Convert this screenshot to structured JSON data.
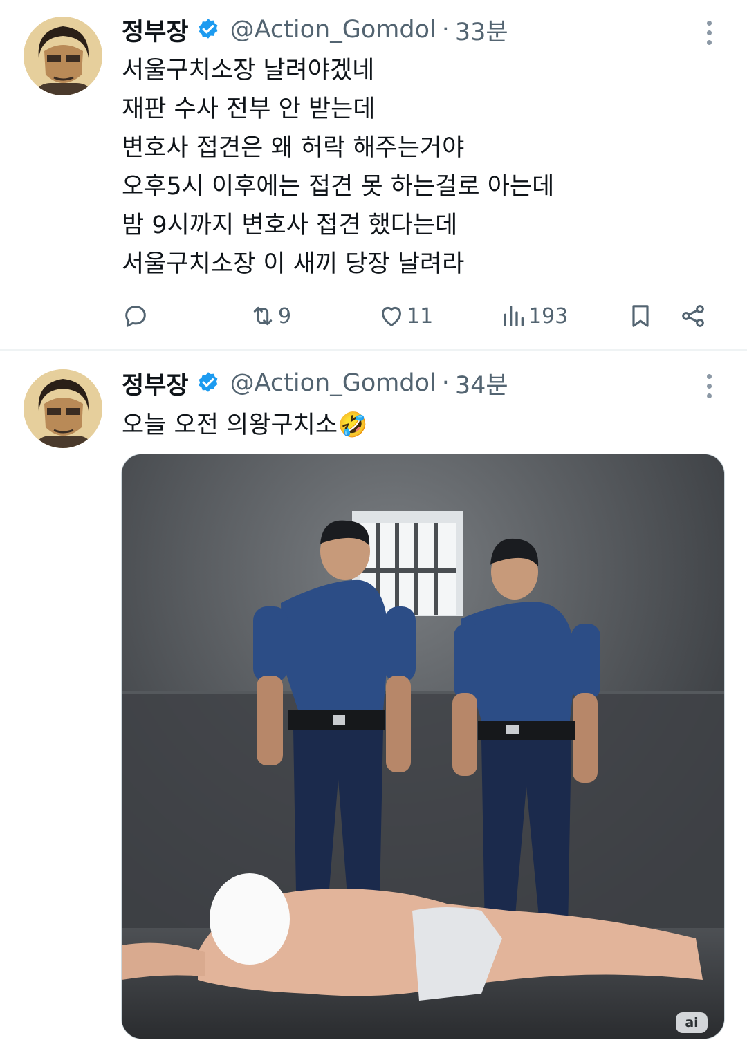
{
  "tweets": [
    {
      "author_name": "정부장",
      "handle": "@Action_Gomdol",
      "separator": "·",
      "time": "33분",
      "lines": [
        "서울구치소장 날려야겠네",
        "재판 수사 전부 안 받는데",
        "변호사 접견은 왜 허락 해주는거야",
        "오후5시 이후에는 접견 못 하는걸로 아는데",
        "밤 9시까지 변호사 접견 했다는데",
        "서울구치소장 이 새끼 당장 날려라"
      ],
      "actions": {
        "reply_icon": "reply-icon",
        "retweet_icon": "retweet-icon",
        "retweets": "9",
        "like_icon": "heart-icon",
        "likes": "11",
        "views_icon": "views-bar-icon",
        "views": "193",
        "bookmark_icon": "bookmark-icon",
        "share_icon": "share-icon"
      }
    },
    {
      "author_name": "정부장",
      "handle": "@Action_Gomdol",
      "separator": "·",
      "time": "34분",
      "lines": [
        "오늘 오전 의왕구치소🤣"
      ],
      "media_badge": "ai"
    }
  ],
  "colors": {
    "text_primary": "#0f1419",
    "text_secondary": "#536471",
    "verified_blue": "#1d9bf0",
    "divider": "#eff3f4"
  }
}
